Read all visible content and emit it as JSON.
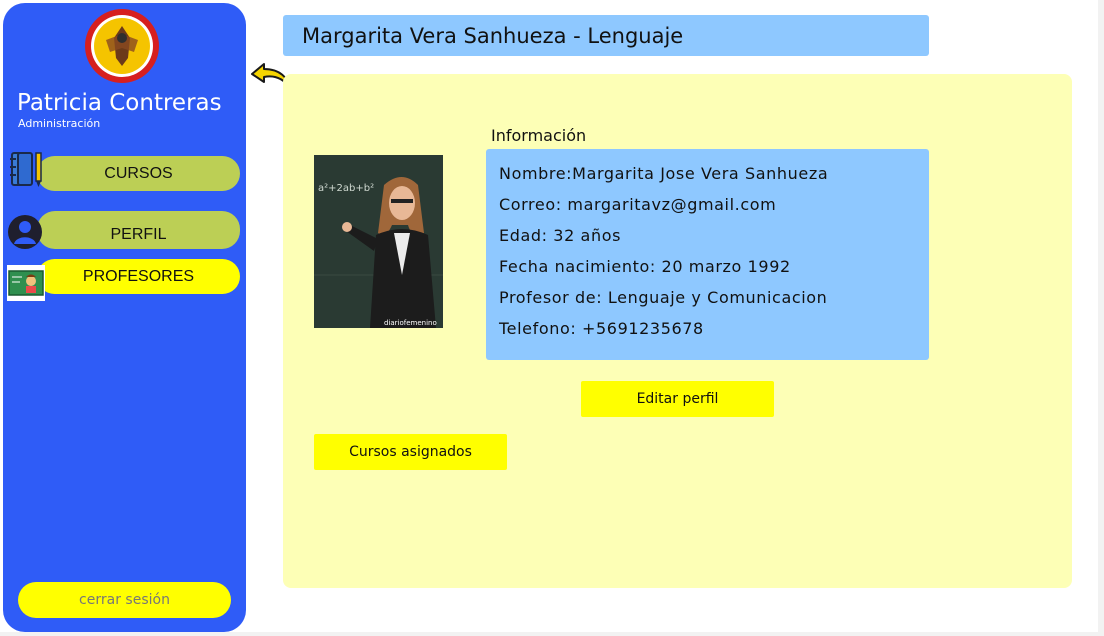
{
  "sidebar": {
    "user_name": "Patricia Contreras",
    "user_role": "Administración",
    "logo_alt": "COLEGIO SAN PEDRO CLAVER BUCARAMANGA",
    "nav": [
      {
        "label": "CURSOS",
        "icon": "notebook-icon"
      },
      {
        "label": "PERFIL",
        "icon": "user-icon"
      },
      {
        "label": "PROFESORES",
        "icon": "teacher-board-icon"
      }
    ],
    "logout_label": "cerrar sesión"
  },
  "header": {
    "title": "Margarita Vera Sanhueza - Lenguaje"
  },
  "profile": {
    "photo_caption": "diariofemenino",
    "info_title": "Información",
    "lines": [
      "Nombre:Margarita Jose Vera Sanhueza",
      "Correo: margaritavz@gmail.com",
      "Edad: 32 años",
      "Fecha nacimiento: 20 marzo 1992",
      "Profesor de: Lenguaje y Comunicacion",
      "Telefono: +5691235678"
    ],
    "edit_button": "Editar perfil",
    "courses_button": "Cursos asignados"
  },
  "colors": {
    "sidebar": "#2f5cf7",
    "nav_inactive": "#bccf55",
    "nav_active": "#ffff00",
    "header": "#8ec8ff",
    "panel": "#fdffb6"
  }
}
